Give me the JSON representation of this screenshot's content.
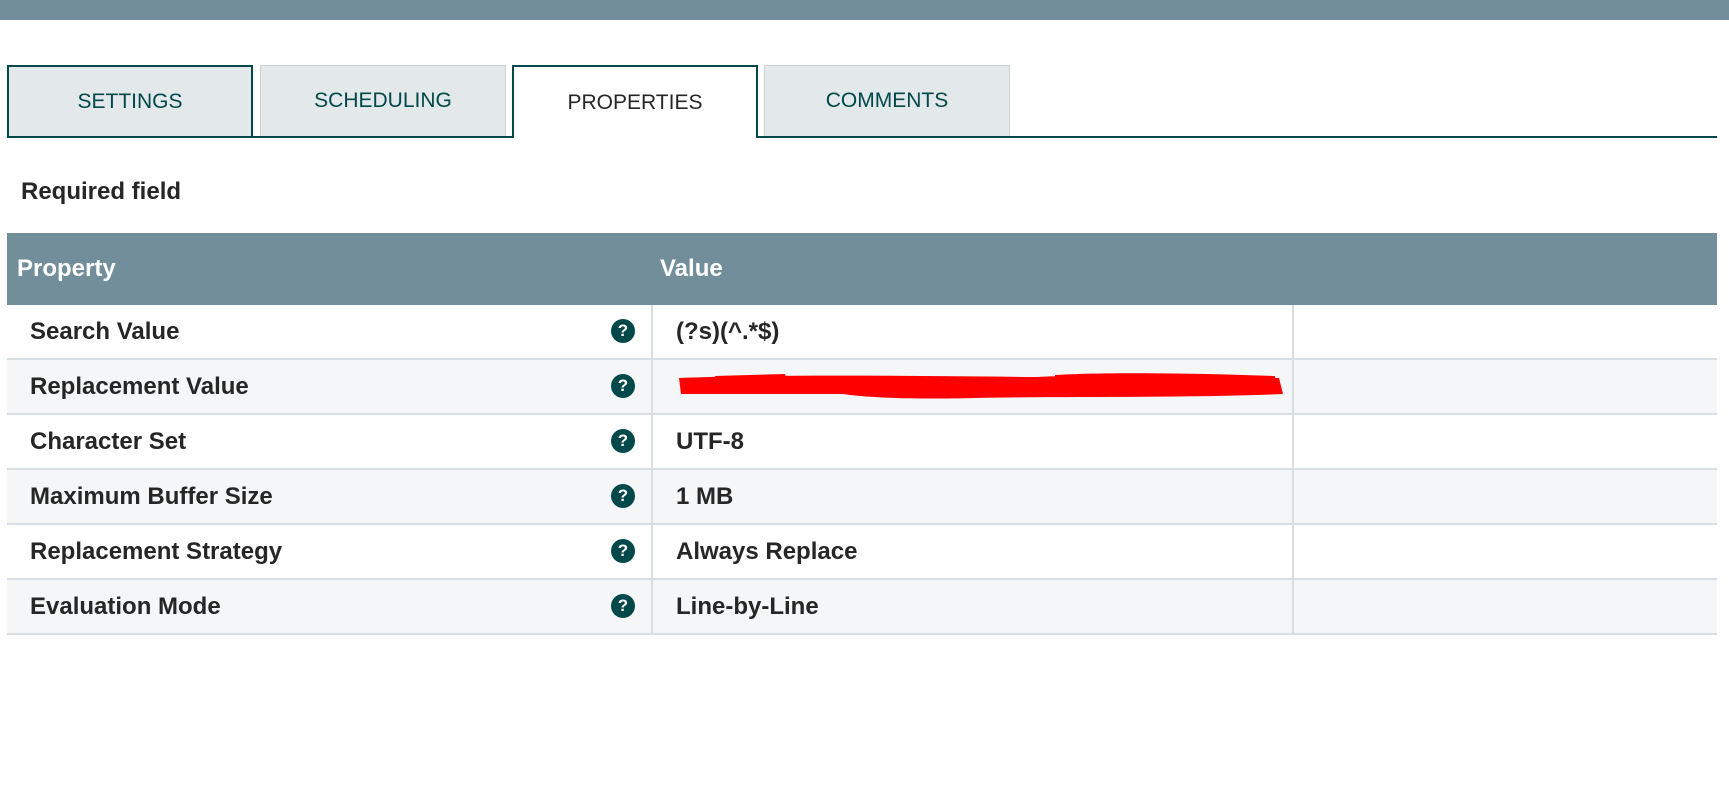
{
  "tabs": [
    {
      "label": "SETTINGS"
    },
    {
      "label": "SCHEDULING"
    },
    {
      "label": "PROPERTIES"
    },
    {
      "label": "COMMENTS"
    }
  ],
  "active_tab": "PROPERTIES",
  "required_label": "Required field",
  "table": {
    "columns": {
      "property": "Property",
      "value": "Value"
    },
    "rows": [
      {
        "name": "Search Value",
        "value": "(?s)(^.*$)"
      },
      {
        "name": "Replacement Value",
        "value": ""
      },
      {
        "name": "Character Set",
        "value": "UTF-8"
      },
      {
        "name": "Maximum Buffer Size",
        "value": "1 MB"
      },
      {
        "name": "Replacement Strategy",
        "value": "Always Replace"
      },
      {
        "name": "Evaluation Mode",
        "value": "Line-by-Line"
      }
    ]
  },
  "help_icon": "question-circle-icon",
  "colors": {
    "header": "#728e9b",
    "accent": "#004849",
    "redaction": "#ff0000"
  }
}
